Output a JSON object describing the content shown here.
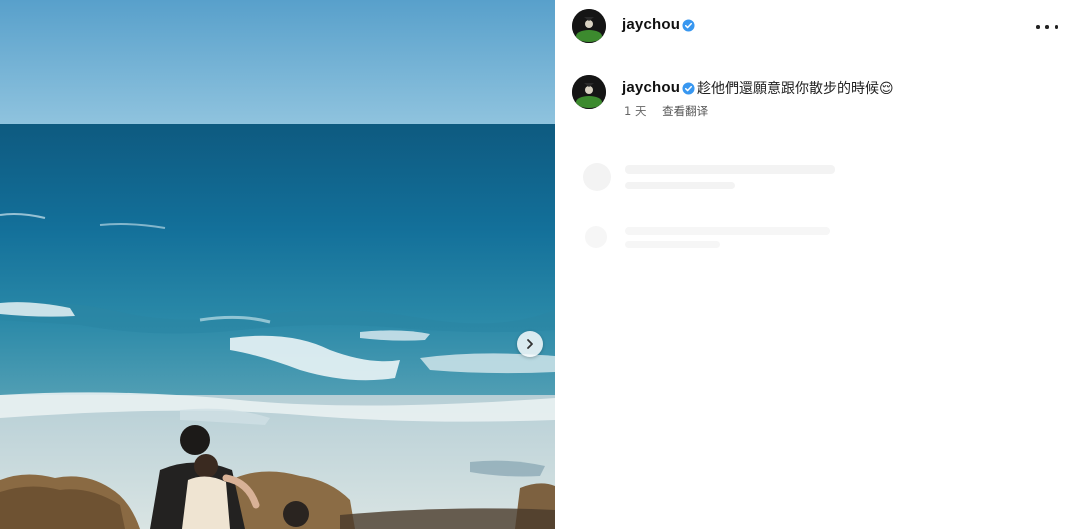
{
  "post": {
    "author": {
      "username": "jaychou",
      "verified": true
    },
    "caption": {
      "text": "趁他們還願意跟你散步的時候😌",
      "time": "1 天",
      "translate_label": "查看翻译"
    }
  },
  "icons": {
    "verified": "verified-badge-icon",
    "more": "more-horizontal-icon",
    "next": "chevron-right-icon"
  },
  "colors": {
    "verified_blue": "#3897f0",
    "panel_bg": "#ffffff",
    "sea_deep": "#0f5f86",
    "sky": "#6aaad0"
  }
}
